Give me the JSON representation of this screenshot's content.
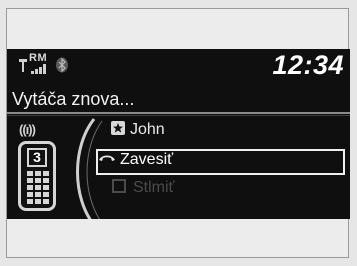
{
  "status": {
    "roaming": "RM",
    "time": "12:34"
  },
  "screen_title": "Vytáča znova...",
  "device": {
    "signal_text": "((ı))",
    "phone_number": "3"
  },
  "menu": {
    "items": [
      {
        "label": "John",
        "icon": "star-contact-icon"
      },
      {
        "label": "Zavesiť",
        "icon": "hang-up-icon"
      },
      {
        "label": "Stlmiť",
        "icon": "checkbox-icon"
      }
    ],
    "selected_index": 1
  }
}
